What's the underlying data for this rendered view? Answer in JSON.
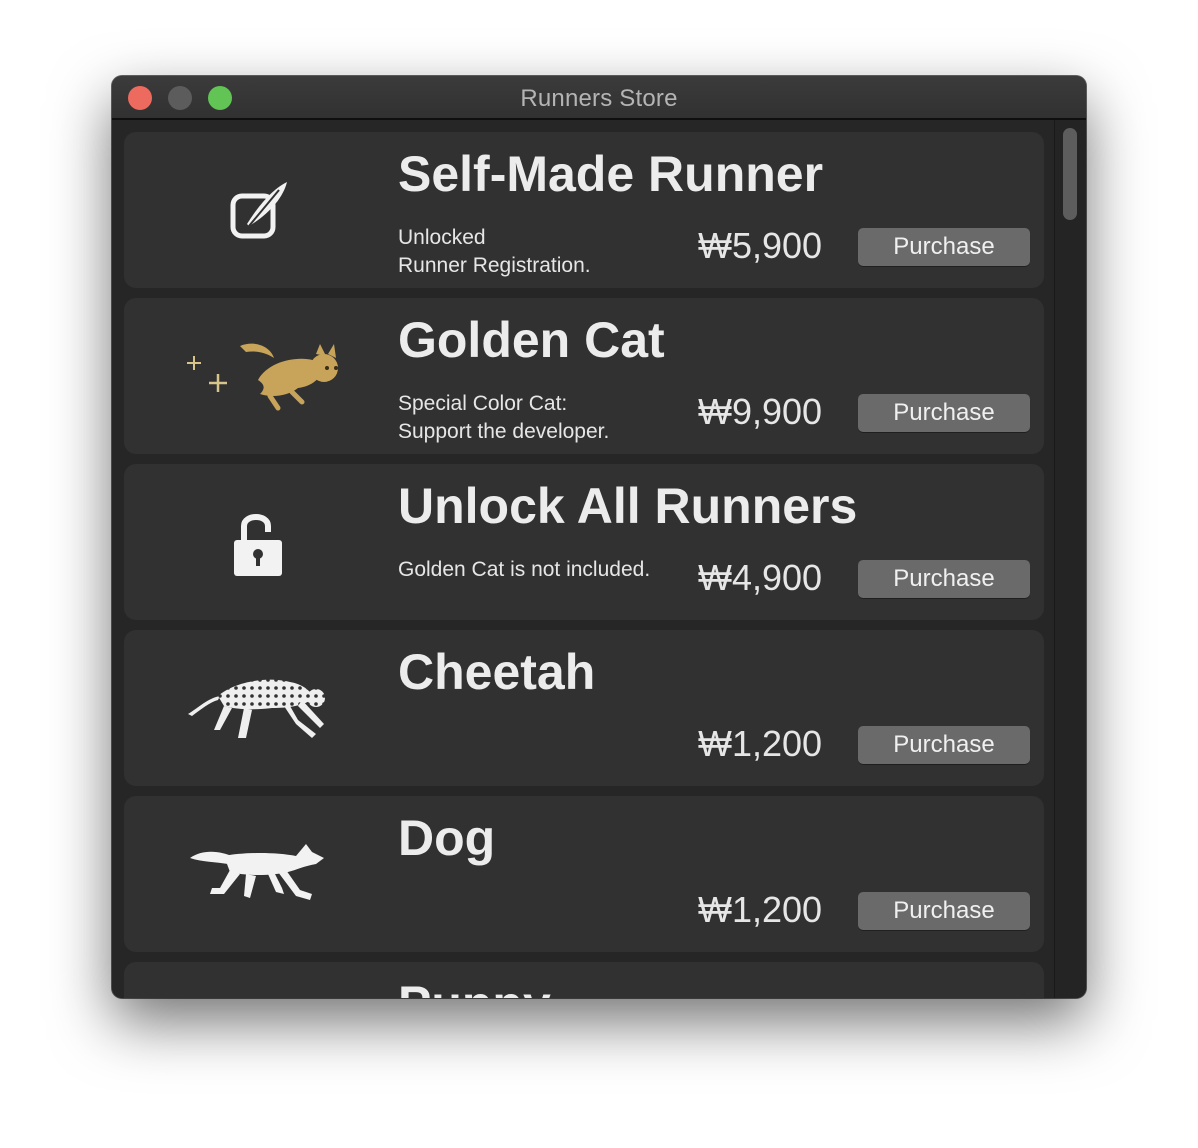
{
  "window": {
    "title": "Runners Store"
  },
  "items": [
    {
      "title": "Self-Made Runner",
      "desc": [
        "Unlocked",
        "Runner Registration."
      ],
      "price": "₩5,900",
      "button": "Purchase",
      "icon": "compose-icon"
    },
    {
      "title": "Golden Cat",
      "desc": [
        "Special Color Cat:",
        "Support the developer."
      ],
      "price": "₩9,900",
      "button": "Purchase",
      "icon": "golden-cat-icon"
    },
    {
      "title": "Unlock All Runners",
      "desc": [
        "Golden Cat is not included.",
        ""
      ],
      "price": "₩4,900",
      "button": "Purchase",
      "icon": "lock-open-icon"
    },
    {
      "title": "Cheetah",
      "desc": [
        "",
        ""
      ],
      "price": "₩1,200",
      "button": "Purchase",
      "icon": "cheetah-icon"
    },
    {
      "title": "Dog",
      "desc": [
        "",
        ""
      ],
      "price": "₩1,200",
      "button": "Purchase",
      "icon": "dog-icon"
    },
    {
      "title": "Puppy",
      "icon": "puppy-icon"
    }
  ],
  "colors": {
    "window_bg": "#262626",
    "card_bg": "#313131",
    "button_bg": "#6a6a6a",
    "close": "#ed6a5e",
    "minimize": "#5c5c5c",
    "maximize": "#61c454",
    "gold": "#c8a45a"
  }
}
